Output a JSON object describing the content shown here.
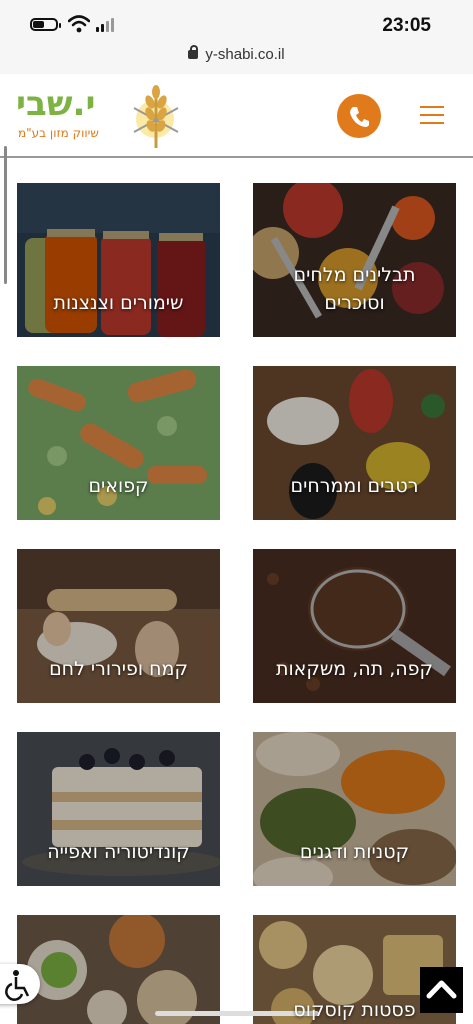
{
  "status_bar": {
    "time": "23:05",
    "url": "y-shabi.co.il"
  },
  "header": {
    "logo_text": "י.שבי",
    "logo_subtitle": "שיווק מזון בע\"מ",
    "colors": {
      "accent": "#e07a1a",
      "logo_green": "#7cb342"
    }
  },
  "categories": [
    {
      "label": "תבלינים מלחים וסוכרים",
      "icon": "spices-image"
    },
    {
      "label": "שימורים וצנצנות",
      "icon": "preserves-jars-image"
    },
    {
      "label": "רטבים וממרחים",
      "icon": "sauces-image"
    },
    {
      "label": "קפואים",
      "icon": "frozen-vegetables-image"
    },
    {
      "label": "קפה, תה, משקאות",
      "icon": "coffee-beans-image"
    },
    {
      "label": "קמח ופירורי לחם",
      "icon": "flour-image"
    },
    {
      "label": "קטניות ודגנים",
      "icon": "legumes-image"
    },
    {
      "label": "קונדיטוריה ואפייה",
      "icon": "pastry-image"
    },
    {
      "label": "פסטות קוסקוס",
      "icon": "pasta-image"
    },
    {
      "label": "",
      "icon": "nuts-dried-fruit-image"
    }
  ]
}
